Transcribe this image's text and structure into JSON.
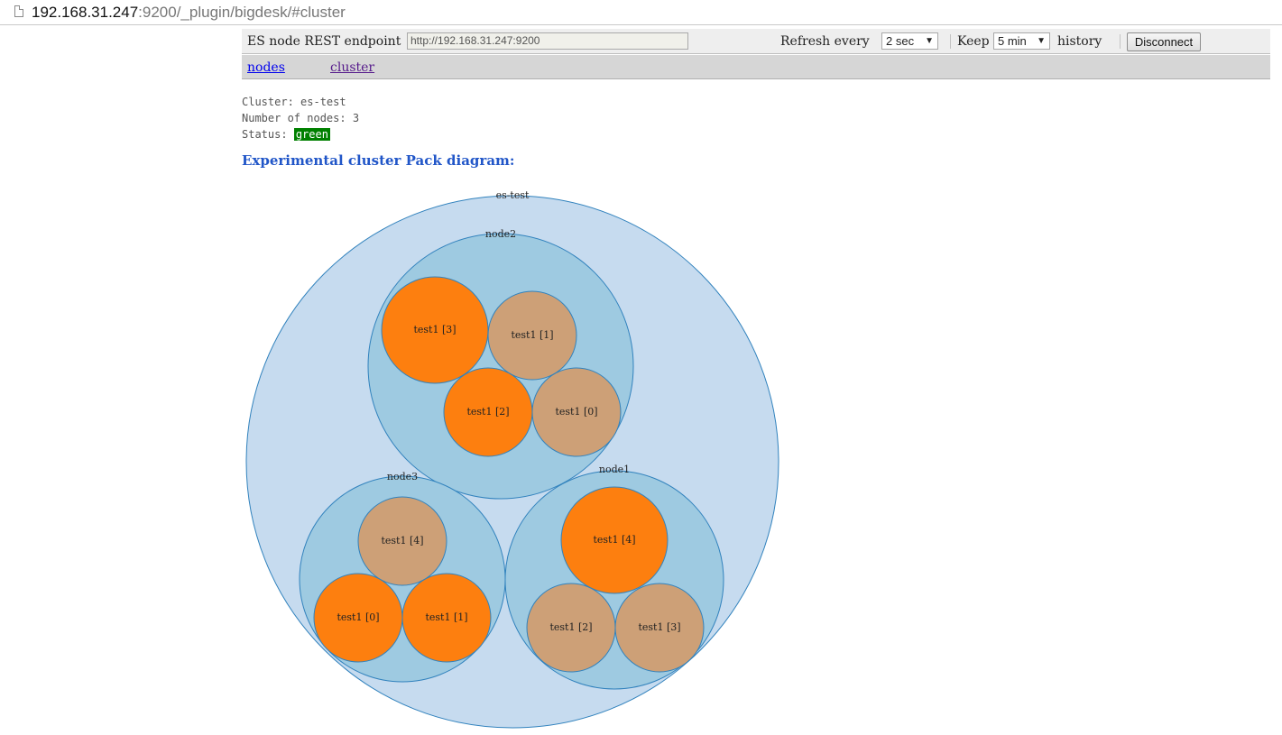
{
  "browser": {
    "url_host": "192.168.31.247",
    "url_rest": ":9200/_plugin/bigdesk/#cluster"
  },
  "toolbar": {
    "endpoint_label": "ES node REST endpoint",
    "endpoint_value": "http://192.168.31.247:9200",
    "refresh_label": "Refresh every",
    "refresh_value": "2 sec",
    "keep_label": "Keep",
    "keep_value": "5 min",
    "history_label": "history",
    "disconnect_label": "Disconnect"
  },
  "tabs": {
    "nodes": "nodes",
    "cluster": "cluster"
  },
  "cluster": {
    "cluster_line": "Cluster: es-test",
    "nodes_line": "Number of nodes: 3",
    "status_label": "Status:",
    "status_value": "green",
    "diagram_title": "Experimental cluster Pack diagram:"
  },
  "colors": {
    "cluster_fill": "#c6dbef",
    "node_fill": "#9ecae1",
    "stroke": "#3182bd",
    "primary_shard": "#fd7f0f",
    "replica_shard": "#cda077",
    "status_green": "#008000"
  },
  "diagram": {
    "cluster_name": "es-test",
    "nodes": [
      {
        "name": "node2",
        "shards": [
          {
            "label": "test1 [3]",
            "role": "primary"
          },
          {
            "label": "test1 [1]",
            "role": "replica"
          },
          {
            "label": "test1 [2]",
            "role": "primary"
          },
          {
            "label": "test1 [0]",
            "role": "replica"
          }
        ]
      },
      {
        "name": "node3",
        "shards": [
          {
            "label": "test1 [4]",
            "role": "replica"
          },
          {
            "label": "test1 [0]",
            "role": "primary"
          },
          {
            "label": "test1 [1]",
            "role": "primary"
          }
        ]
      },
      {
        "name": "node1",
        "shards": [
          {
            "label": "test1 [4]",
            "role": "primary"
          },
          {
            "label": "test1 [2]",
            "role": "replica"
          },
          {
            "label": "test1 [3]",
            "role": "replica"
          }
        ]
      }
    ]
  }
}
